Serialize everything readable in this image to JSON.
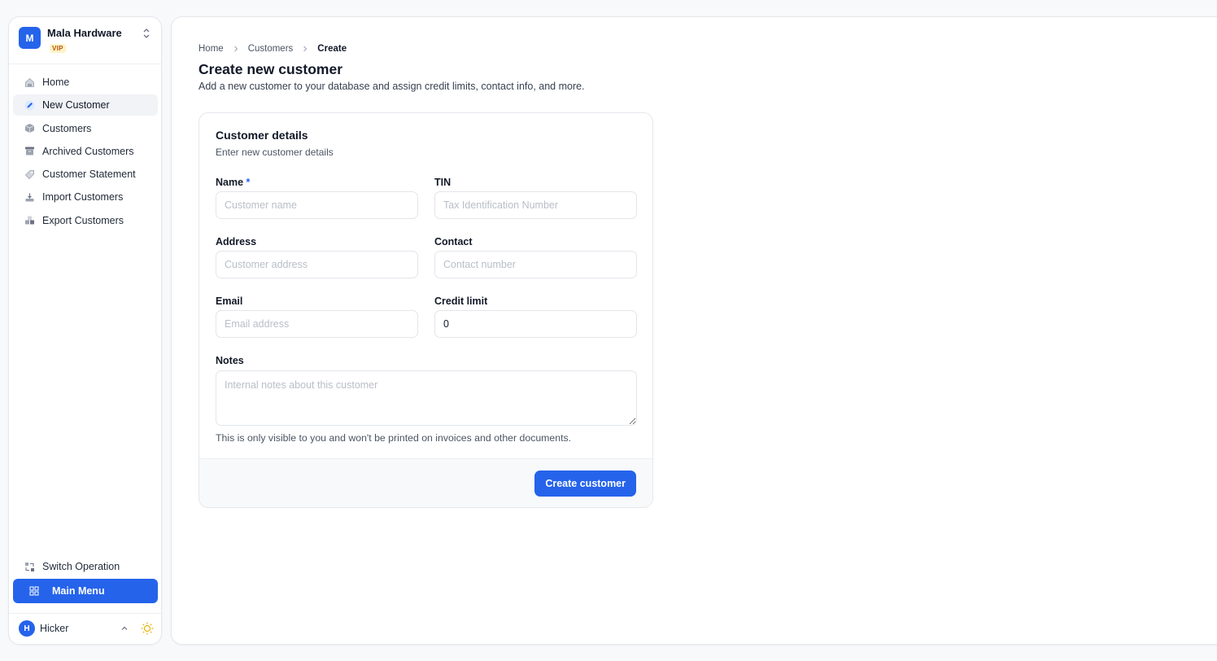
{
  "org": {
    "initial": "M",
    "name": "Mala Hardware",
    "badge": "VIP"
  },
  "sidebar": {
    "items": [
      {
        "label": "Home",
        "icon": "home-icon",
        "active": false
      },
      {
        "label": "New Customer",
        "icon": "edit-icon",
        "active": true
      },
      {
        "label": "Customers",
        "icon": "box-icon",
        "active": false
      },
      {
        "label": "Archived Customers",
        "icon": "archive-icon",
        "active": false
      },
      {
        "label": "Customer Statement",
        "icon": "tag-icon",
        "active": false
      },
      {
        "label": "Import Customers",
        "icon": "import-icon",
        "active": false
      },
      {
        "label": "Export Customers",
        "icon": "export-icon",
        "active": false
      }
    ],
    "switch_operation": "Switch Operation",
    "main_menu": "Main Menu"
  },
  "user": {
    "initial": "H",
    "name": "Hicker"
  },
  "breadcrumb": [
    "Home",
    "Customers",
    "Create"
  ],
  "page": {
    "title": "Create new customer",
    "description": "Add a new customer to your database and assign credit limits, contact info, and more."
  },
  "form": {
    "title": "Customer details",
    "subtitle": "Enter new customer details",
    "name": {
      "label": "Name",
      "required_mark": "*",
      "placeholder": "Customer name",
      "value": ""
    },
    "tin": {
      "label": "TIN",
      "placeholder": "Tax Identification Number",
      "value": ""
    },
    "address": {
      "label": "Address",
      "placeholder": "Customer address",
      "value": ""
    },
    "contact": {
      "label": "Contact",
      "placeholder": "Contact number",
      "value": ""
    },
    "email": {
      "label": "Email",
      "placeholder": "Email address",
      "value": ""
    },
    "credit_limit": {
      "label": "Credit limit",
      "placeholder": "",
      "value": "0"
    },
    "notes": {
      "label": "Notes",
      "placeholder": "Internal notes about this customer",
      "value": "",
      "helper": "This is only visible to you and won't be printed on invoices and other documents."
    },
    "submit_label": "Create customer"
  },
  "colors": {
    "accent": "#2563eb",
    "badge_text": "#b45309",
    "badge_bg": "#fef3c7",
    "theme_icon": "#eab308"
  }
}
